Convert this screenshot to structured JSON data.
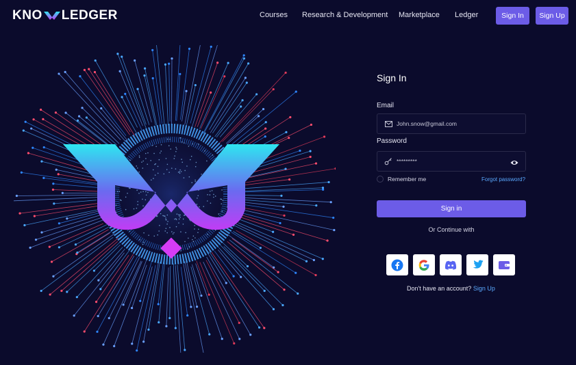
{
  "header": {
    "logo_left": "KNO",
    "logo_right": "LEDGER",
    "nav": {
      "courses": "Courses",
      "research": "Research & Development",
      "marketplace": "Marketplace",
      "ledger": "Ledger"
    },
    "signin_label": "Sign In",
    "signup_label": "Sign Up"
  },
  "form": {
    "title": "Sign In",
    "email_label": "Email",
    "email_value": "John.snow@gmail.com",
    "password_label": "Password",
    "password_value": "*********",
    "remember_label": "Remember me",
    "forgot_label": "Forgot password?",
    "submit_label": "Sign in",
    "divider_text": "Or Continue with",
    "no_account_text": "Don't have an account?",
    "signup_link": "Sign Up"
  },
  "socials": [
    {
      "name": "facebook-icon",
      "color": "#1877f2"
    },
    {
      "name": "google-icon",
      "color": "#4285f4"
    },
    {
      "name": "discord-icon",
      "color": "#5865f2"
    },
    {
      "name": "twitter-icon",
      "color": "#1da1f2"
    },
    {
      "name": "wallet-icon",
      "color": "#6c5ce7"
    }
  ],
  "colors": {
    "background": "#0b0b2c",
    "accent": "#6c5ce7",
    "link": "#5aa9ff",
    "logo_gradient_top": "#2ee6f0",
    "logo_gradient_bottom": "#c13cf5"
  }
}
